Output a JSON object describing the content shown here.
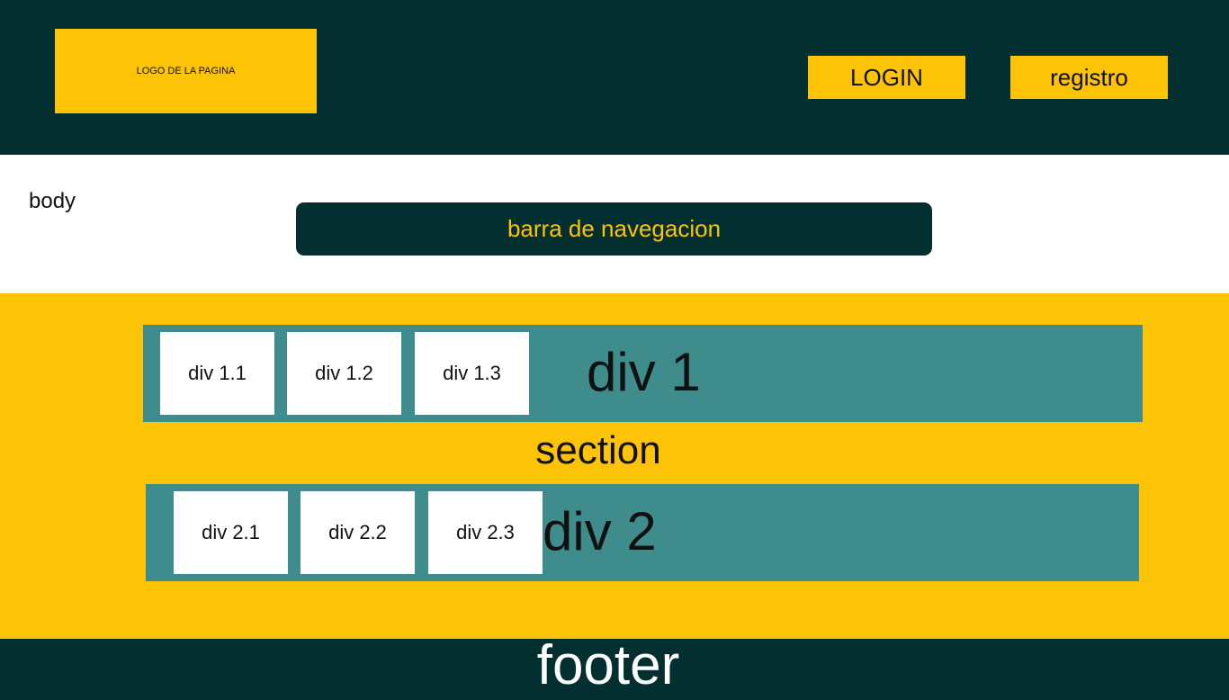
{
  "header": {
    "logo_text": "LOGO  DE LA PAGINA",
    "login_label": "LOGIN",
    "registro_label": "registro"
  },
  "body_label": "body",
  "nav": {
    "label": "barra de navegacion"
  },
  "section": {
    "label": "section",
    "div1": {
      "label": "div 1",
      "items": [
        "div 1.1",
        "div 1.2",
        "div 1.3"
      ]
    },
    "div2": {
      "label": "div 2",
      "items": [
        "div 2.1",
        "div 2.2",
        "div 2.3"
      ]
    }
  },
  "footer": {
    "label": "footer"
  },
  "colors": {
    "dark": "#032f31",
    "accent": "#fdc306",
    "teal": "#3e8c8b",
    "white": "#ffffff"
  }
}
